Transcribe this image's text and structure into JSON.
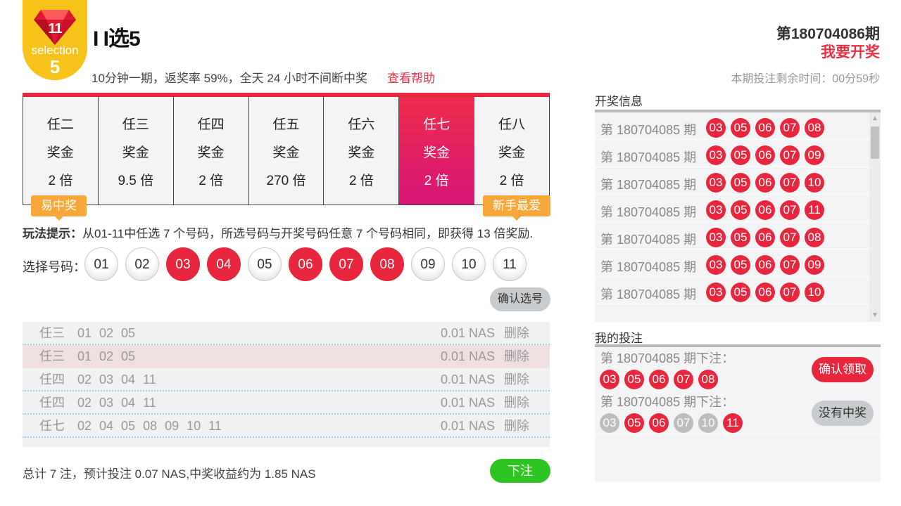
{
  "logo": {
    "gem_number": "11",
    "selection_text": "selection",
    "five": "5"
  },
  "header": {
    "title": "I I选5",
    "subtitle": "10分钟一期，返奖率 59%，全天 24 小时不间断中奖",
    "help_link": "查看帮助",
    "issue": "第180704086期",
    "draw_link": "我要开奖",
    "countdown": "本期投注剩余时间：00分59秒"
  },
  "tabs": [
    {
      "name": "任二",
      "prize_label": "奖金",
      "multiple": "2 倍",
      "active": false
    },
    {
      "name": "任三",
      "prize_label": "奖金",
      "multiple": "9.5 倍",
      "active": false
    },
    {
      "name": "任四",
      "prize_label": "奖金",
      "multiple": "2 倍",
      "active": false
    },
    {
      "name": "任五",
      "prize_label": "奖金",
      "multiple": "270 倍",
      "active": false
    },
    {
      "name": "任六",
      "prize_label": "奖金",
      "multiple": "2 倍",
      "active": false
    },
    {
      "name": "任七",
      "prize_label": "奖金",
      "multiple": "2 倍",
      "active": true
    },
    {
      "name": "任八",
      "prize_label": "奖金",
      "multiple": "2 倍",
      "active": false
    }
  ],
  "ribbons": {
    "left": "易中奖",
    "right": "新手最爱"
  },
  "hint": {
    "label": "玩法提示：",
    "text": "从01-11中任选 7 个号码，所选号码与开奖号码任意 7 个号码相同，即获得 13 倍奖励."
  },
  "picker": {
    "label": "选择号码：",
    "numbers": [
      "01",
      "02",
      "03",
      "04",
      "05",
      "06",
      "07",
      "08",
      "09",
      "10",
      "11"
    ],
    "selected": [
      "03",
      "04",
      "06",
      "07",
      "08"
    ],
    "confirm": "确认选号"
  },
  "bets": [
    {
      "type": "任三",
      "nums": "01 02 05",
      "amount": "0.01 NAS",
      "delete": "删除",
      "highlight": false
    },
    {
      "type": "任三",
      "nums": "01 02 05",
      "amount": "0.01 NAS",
      "delete": "删除",
      "highlight": true
    },
    {
      "type": "任四",
      "nums": "02 03 04 11",
      "amount": "0.01 NAS",
      "delete": "删除",
      "highlight": false
    },
    {
      "type": "任四",
      "nums": "02 03 04 11",
      "amount": "0.01 NAS",
      "delete": "删除",
      "highlight": false
    },
    {
      "type": "任七",
      "nums": "02 04 05 08 09 10 11",
      "amount": "0.01 NAS",
      "delete": "删除",
      "highlight": false
    }
  ],
  "summary": {
    "total": "总计 7 注，预计投注 0.07 NAS,中奖收益约为 1.85 NAS",
    "submit": "下注"
  },
  "results": {
    "title": "开奖信息",
    "rows": [
      {
        "period": "第 180704085 期",
        "balls": [
          "03",
          "05",
          "06",
          "07",
          "08"
        ]
      },
      {
        "period": "第 180704085 期",
        "balls": [
          "03",
          "05",
          "06",
          "07",
          "09"
        ]
      },
      {
        "period": "第 180704085 期",
        "balls": [
          "03",
          "05",
          "06",
          "07",
          "10"
        ]
      },
      {
        "period": "第 180704085 期",
        "balls": [
          "03",
          "05",
          "06",
          "07",
          "11"
        ]
      },
      {
        "period": "第 180704085 期",
        "balls": [
          "03",
          "05",
          "06",
          "07",
          "08"
        ]
      },
      {
        "period": "第 180704085 期",
        "balls": [
          "03",
          "05",
          "06",
          "07",
          "09"
        ]
      },
      {
        "period": "第 180704085 期",
        "balls": [
          "03",
          "05",
          "06",
          "07",
          "10"
        ]
      }
    ]
  },
  "my_bets": {
    "title": "我的投注",
    "entries": [
      {
        "period": "第 180704085 期下注：",
        "balls": [
          "03",
          "05",
          "06",
          "07",
          "08"
        ],
        "grey": [],
        "button": "确认领取",
        "button_style": "red"
      },
      {
        "period": "第 180704085 期下注：",
        "balls": [
          "03",
          "05",
          "06",
          "07",
          "10",
          "11"
        ],
        "grey": [
          "03",
          "07",
          "10"
        ],
        "button": "没有中奖",
        "button_style": "grey"
      }
    ]
  },
  "colors": {
    "accent_red": "#e8273e",
    "gold": "#f7c21a",
    "green": "#2ec522",
    "orange": "#f7a83a"
  }
}
